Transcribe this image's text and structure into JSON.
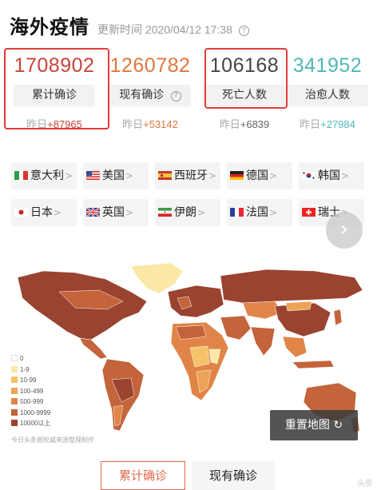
{
  "header": {
    "title": "海外疫情",
    "update_label": "更新时间",
    "update_time": "2020/04/12 17:38"
  },
  "stats": [
    {
      "value": "1708902",
      "label": "累计确诊",
      "delta_prefix": "昨日",
      "delta": "+87965",
      "color": "#c8433a"
    },
    {
      "value": "1260782",
      "label": "现有确诊",
      "delta_prefix": "昨日",
      "delta": "+53142",
      "color": "#e0773d"
    },
    {
      "value": "106168",
      "label": "死亡人数",
      "delta_prefix": "昨日",
      "delta": "+6839",
      "color": "#444444"
    },
    {
      "value": "341952",
      "label": "治愈人数",
      "delta_prefix": "昨日",
      "delta": "+27984",
      "color": "#4fb7b7"
    }
  ],
  "countries": [
    {
      "name": "意大利",
      "flag": "italy-flag-icon"
    },
    {
      "name": "美国",
      "flag": "usa-flag-icon"
    },
    {
      "name": "西班牙",
      "flag": "spain-flag-icon"
    },
    {
      "name": "德国",
      "flag": "germany-flag-icon"
    },
    {
      "name": "韩国",
      "flag": "korea-flag-icon"
    },
    {
      "name": "日本",
      "flag": "japan-flag-icon"
    },
    {
      "name": "英国",
      "flag": "uk-flag-icon"
    },
    {
      "name": "伊朗",
      "flag": "iran-flag-icon"
    },
    {
      "name": "法国",
      "flag": "france-flag-icon"
    },
    {
      "name": "瑞士",
      "flag": "switzerland-flag-icon"
    }
  ],
  "legend": [
    {
      "label": "0",
      "color": "#ffffff"
    },
    {
      "label": "1-9",
      "color": "#fbe8a6"
    },
    {
      "label": "10-99",
      "color": "#f5c26a"
    },
    {
      "label": "100-499",
      "color": "#eda357"
    },
    {
      "label": "500-999",
      "color": "#e08547"
    },
    {
      "label": "1000-9999",
      "color": "#c3643b"
    },
    {
      "label": "10000以上",
      "color": "#9a4330"
    }
  ],
  "source": "今日头条据权威来源整理制作",
  "reset_button": "重置地图",
  "tabs": [
    "累计确诊",
    "现有确诊"
  ],
  "watermark": "头条"
}
